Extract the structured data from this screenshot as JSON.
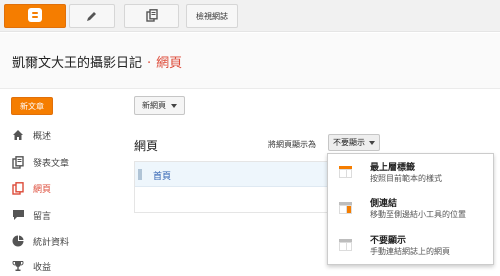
{
  "toolbar": {
    "view_blog_label": "檢視網誌"
  },
  "header": {
    "blog_title": "凱爾文大王的攝影日記",
    "separator": "·",
    "page_name": "網頁"
  },
  "sidebar": {
    "new_post_label": "新文章",
    "items": [
      {
        "label": "概述",
        "icon": "home-icon"
      },
      {
        "label": "發表文章",
        "icon": "posts-icon"
      },
      {
        "label": "網頁",
        "icon": "pages-icon",
        "active": true
      },
      {
        "label": "留言",
        "icon": "comment-icon"
      },
      {
        "label": "統計資料",
        "icon": "pie-chart-icon"
      },
      {
        "label": "收益",
        "icon": "trophy-icon"
      }
    ]
  },
  "main": {
    "new_page_label": "新網頁",
    "heading": "網頁",
    "display_as_label": "將網頁顯示為",
    "display_value": "不要顯示",
    "pages": [
      {
        "title": "首頁"
      }
    ]
  },
  "menu": {
    "items": [
      {
        "title": "最上層標籤",
        "desc": "按照目前範本的樣式",
        "icon": "top-tabs-icon"
      },
      {
        "title": "側連結",
        "desc": "移動至側邊結小工具的位置",
        "icon": "side-links-icon"
      },
      {
        "title": "不要顯示",
        "desc": "手動連結網誌上的網頁",
        "icon": "hidden-icon"
      }
    ]
  },
  "colors": {
    "accent": "#f57d00",
    "link_red": "#dd4b39",
    "link_blue": "#2a5db0"
  }
}
